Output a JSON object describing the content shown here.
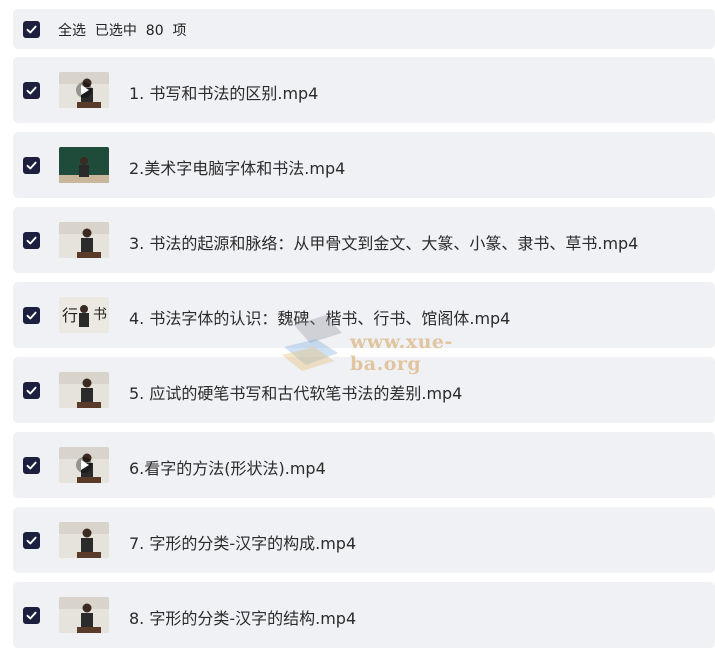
{
  "header": {
    "select_all_label": "全选  已选中  80  项",
    "checked": true
  },
  "files": [
    {
      "name": "1. 书写和书法的区别.mp4",
      "checked": true,
      "thumb_style": "play"
    },
    {
      "name": "2.美术字电脑字体和书法.mp4",
      "checked": true,
      "thumb_style": "chalkboard"
    },
    {
      "name": "3. 书法的起源和脉络：从甲骨文到金文、大篆、小篆、隶书、草书.mp4",
      "checked": true,
      "thumb_style": "lecturer"
    },
    {
      "name": "4. 书法字体的认识：魏碑、楷书、行书、馆阁体.mp4",
      "checked": true,
      "thumb_style": "calligraphy"
    },
    {
      "name": "5. 应试的硬笔书写和古代软笔书法的差别.mp4",
      "checked": true,
      "thumb_style": "lecturer"
    },
    {
      "name": "6.看字的方法(形状法).mp4",
      "checked": true,
      "thumb_style": "play"
    },
    {
      "name": "7. 字形的分类-汉字的构成.mp4",
      "checked": true,
      "thumb_style": "lecturer"
    },
    {
      "name": "8. 字形的分类-汉字的结构.mp4",
      "checked": true,
      "thumb_style": "lecturer"
    }
  ],
  "watermark": {
    "text": "www.xue-ba.org"
  },
  "colors": {
    "row_bg": "#f0f1f4",
    "checkbox": "#1c1f3d",
    "text": "#2b2b2b"
  }
}
